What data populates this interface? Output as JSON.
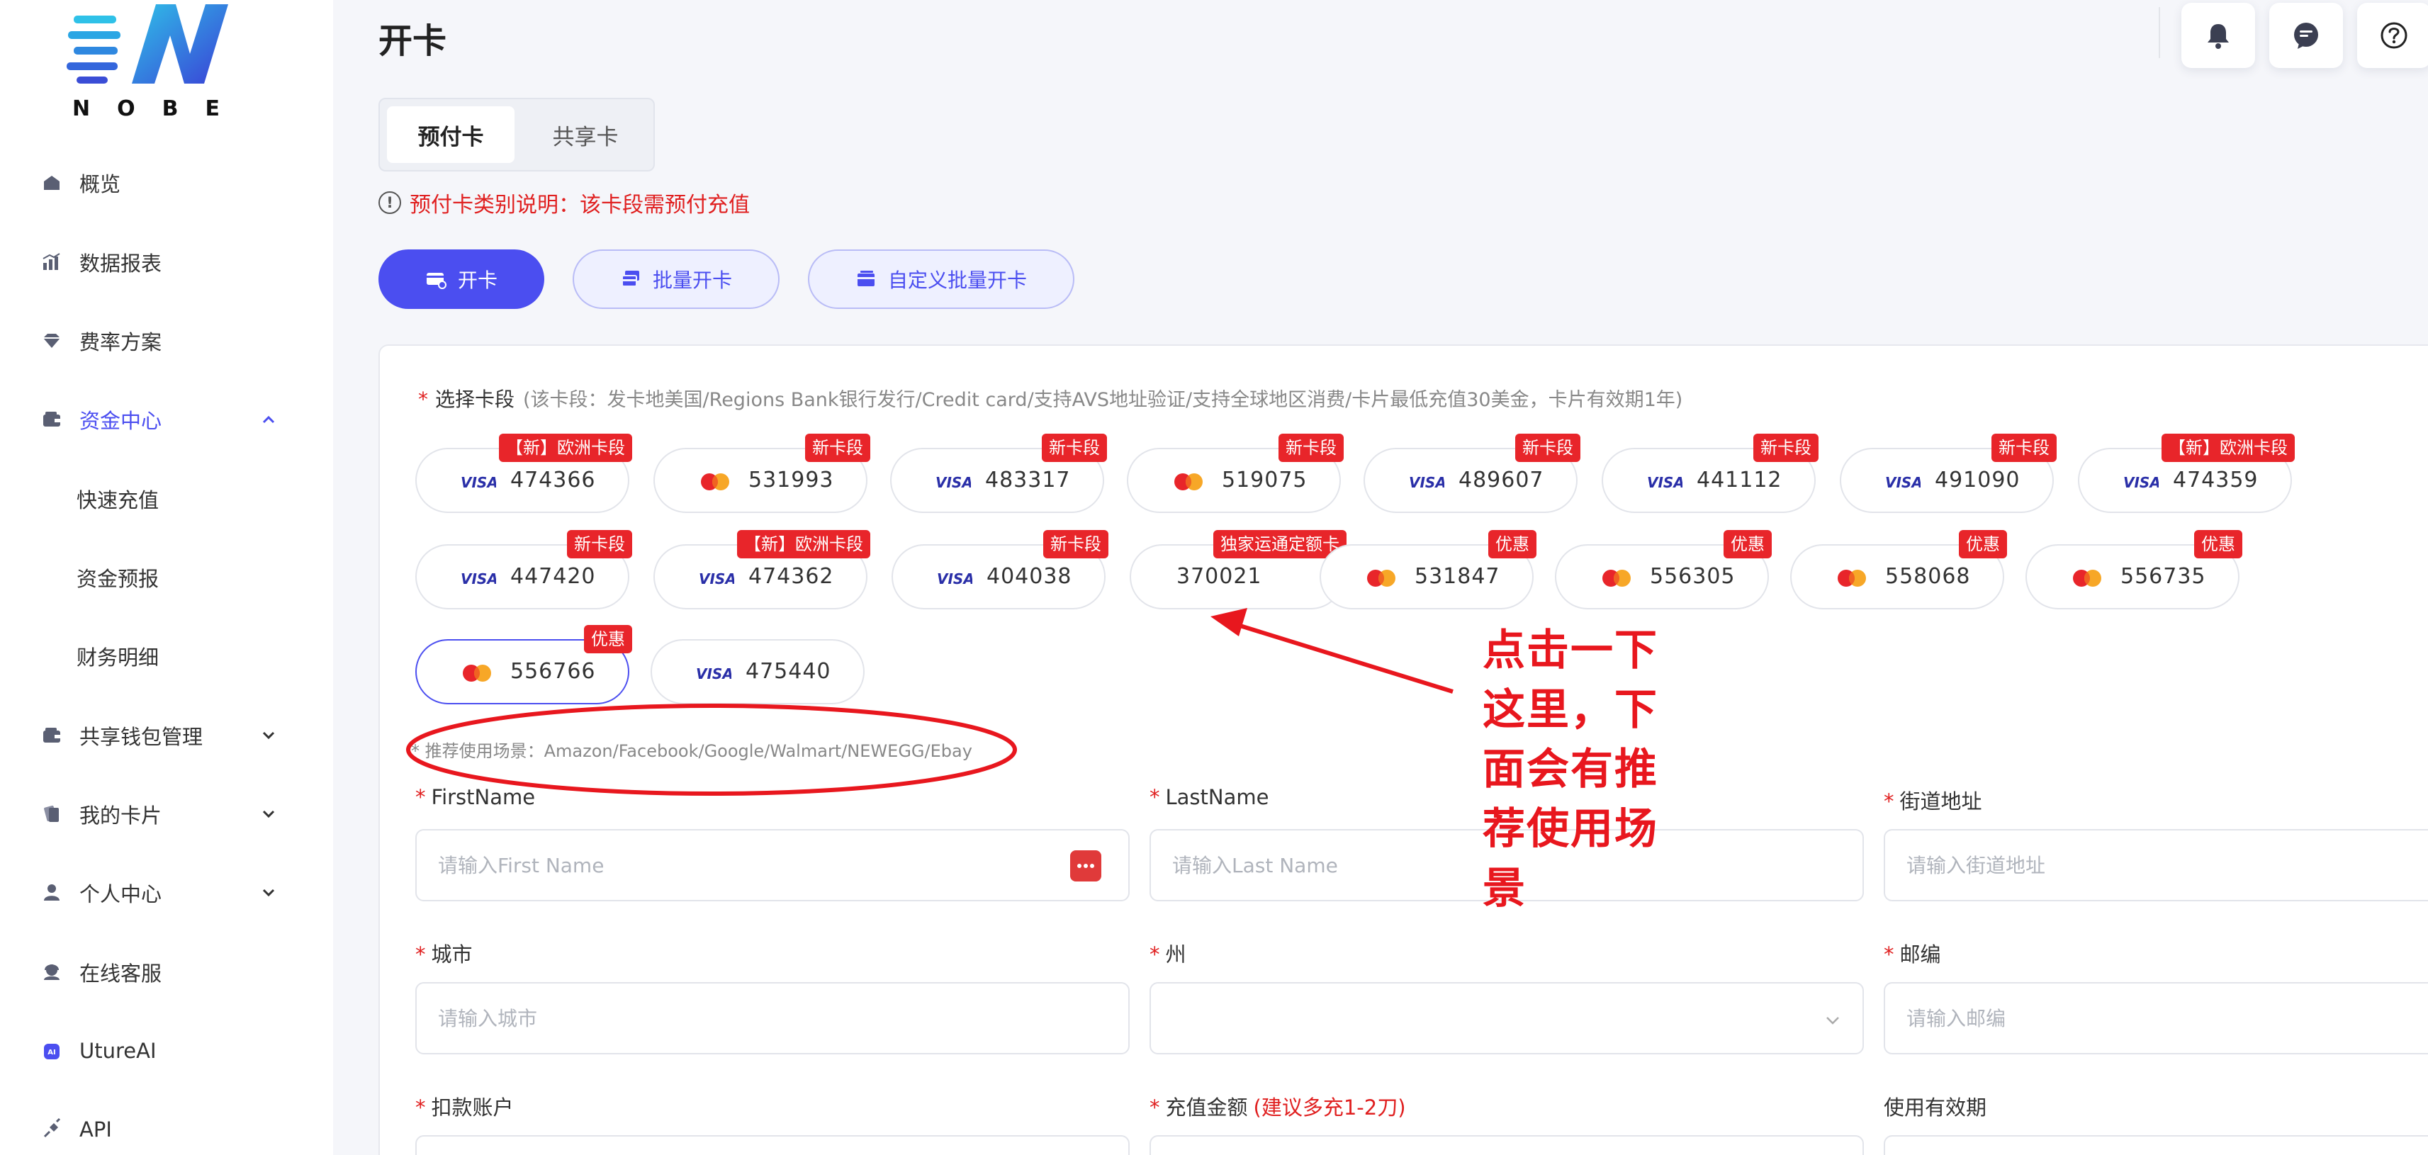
{
  "brand": {
    "wordmark": "NOBE"
  },
  "sidebar": {
    "items": [
      {
        "label": "概览",
        "icon": "home-icon"
      },
      {
        "label": "数据报表",
        "icon": "bar-chart-icon"
      },
      {
        "label": "费率方案",
        "icon": "diamond-icon"
      },
      {
        "label": "资金中心",
        "icon": "wallet-icon",
        "expanded": true,
        "active": true
      },
      {
        "label": "快速充值",
        "sub": true
      },
      {
        "label": "资金预报",
        "sub": true
      },
      {
        "label": "财务明细",
        "sub": true
      },
      {
        "label": "共享钱包管理",
        "icon": "wallet-icon",
        "expanded": false
      },
      {
        "label": "我的卡片",
        "icon": "cards-icon",
        "expanded": false
      },
      {
        "label": "个人中心",
        "icon": "user-icon",
        "expanded": false
      },
      {
        "label": "在线客服",
        "icon": "support-icon"
      },
      {
        "label": "UtureAI",
        "icon": "ai-icon"
      },
      {
        "label": "API",
        "icon": "api-icon"
      }
    ]
  },
  "header": {
    "title": "开卡",
    "icons": [
      "bell-icon",
      "message-icon",
      "help-icon"
    ]
  },
  "tabs": [
    {
      "label": "预付卡",
      "active": true
    },
    {
      "label": "共享卡",
      "active": false
    }
  ],
  "note": {
    "icon": "!",
    "text": "预付卡类别说明：该卡段需预付充值"
  },
  "actions": [
    {
      "label": "开卡",
      "style": "primary"
    },
    {
      "label": "批量开卡",
      "style": "outline"
    },
    {
      "label": "自定义批量开卡",
      "style": "outline"
    }
  ],
  "card_section": {
    "required_mark": "*",
    "label": "选择卡段",
    "hint": "(该卡段：发卡地美国/Regions Bank银行发行/Credit card/支持AVS地址验证/支持全球地区消费/卡片最低充值30美金，卡片有效期1年)"
  },
  "cards": [
    {
      "number": "474366",
      "brand": "visa",
      "badge": "【新】欧洲卡段"
    },
    {
      "number": "531993",
      "brand": "mastercard",
      "badge": "新卡段"
    },
    {
      "number": "483317",
      "brand": "visa",
      "badge": "新卡段"
    },
    {
      "number": "519075",
      "brand": "mastercard",
      "badge": "新卡段"
    },
    {
      "number": "489607",
      "brand": "visa",
      "badge": "新卡段"
    },
    {
      "number": "441112",
      "brand": "visa",
      "badge": "新卡段"
    },
    {
      "number": "491090",
      "brand": "visa",
      "badge": "新卡段"
    },
    {
      "number": "474359",
      "brand": "visa",
      "badge": "【新】欧洲卡段"
    },
    {
      "number": "447420",
      "brand": "visa",
      "badge": "新卡段"
    },
    {
      "number": "474362",
      "brand": "visa",
      "badge": "【新】欧洲卡段"
    },
    {
      "number": "404038",
      "brand": "visa",
      "badge": "新卡段"
    },
    {
      "number": "370021",
      "brand": "none",
      "badge": "独家运通定额卡"
    },
    {
      "number": "531847",
      "brand": "mastercard",
      "badge": "优惠"
    },
    {
      "number": "556305",
      "brand": "mastercard",
      "badge": "优惠"
    },
    {
      "number": "558068",
      "brand": "mastercard",
      "badge": "优惠"
    },
    {
      "number": "556735",
      "brand": "mastercard",
      "badge": "优惠"
    },
    {
      "number": "556766",
      "brand": "mastercard",
      "badge": "优惠",
      "selected": true
    },
    {
      "number": "475440",
      "brand": "visa",
      "badge": ""
    }
  ],
  "visa_text": "VISA",
  "scene": {
    "text": "* 推荐使用场景：Amazon/Facebook/Google/Walmart/NEWEGG/Ebay"
  },
  "form": {
    "fields": [
      {
        "label": "FirstName",
        "required": true,
        "placeholder": "请输入First Name",
        "type": "text",
        "has_badge": true
      },
      {
        "label": "LastName",
        "required": true,
        "placeholder": "请输入Last Name",
        "type": "text"
      },
      {
        "label": "街道地址",
        "required": true,
        "placeholder": "请输入街道地址",
        "type": "text"
      },
      {
        "label": "城市",
        "required": true,
        "placeholder": "请输入城市",
        "type": "text"
      },
      {
        "label": "州",
        "required": true,
        "placeholder": "",
        "type": "select"
      },
      {
        "label": "邮编",
        "required": true,
        "placeholder": "请输入邮编",
        "type": "text"
      },
      {
        "label": "扣款账户",
        "required": true,
        "placeholder": "",
        "type": "text"
      },
      {
        "label": "充值金额",
        "required": true,
        "hint": "(建议多充1-2刀)",
        "placeholder": "",
        "type": "text"
      },
      {
        "label": "使用有效期",
        "required": false,
        "placeholder": "",
        "type": "text"
      }
    ]
  },
  "annotation": {
    "text_lines": [
      "点击一下",
      "这里，下",
      "面会有推",
      "荐使用场",
      "景"
    ],
    "color": "#e8171e"
  },
  "colors": {
    "accent": "#4b4ef0",
    "danger": "#e02020",
    "badge": "#e8252a"
  }
}
